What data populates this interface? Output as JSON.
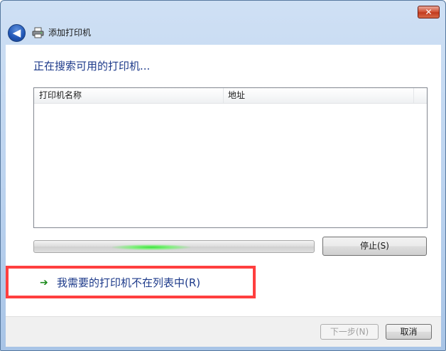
{
  "window": {
    "close_glyph": "✕"
  },
  "nav": {
    "back_glyph": "◀",
    "title": "添加打印机",
    "icon": "printer-icon"
  },
  "main": {
    "heading": "正在搜索可用的打印机...",
    "list": {
      "columns": [
        "打印机名称",
        "地址"
      ],
      "rows": []
    },
    "progress": {
      "state": "searching (indeterminate)"
    },
    "stop_button": "停止(S)",
    "not_listed_arrow": "➔",
    "not_listed_link": "我需要的打印机不在列表中(R)"
  },
  "footer": {
    "next_button": "下一步(N)",
    "cancel_button": "取消"
  },
  "colors": {
    "heading": "#1d3a8a",
    "highlight_border": "#ff3f3f",
    "progress_glow": "#39e23a"
  }
}
